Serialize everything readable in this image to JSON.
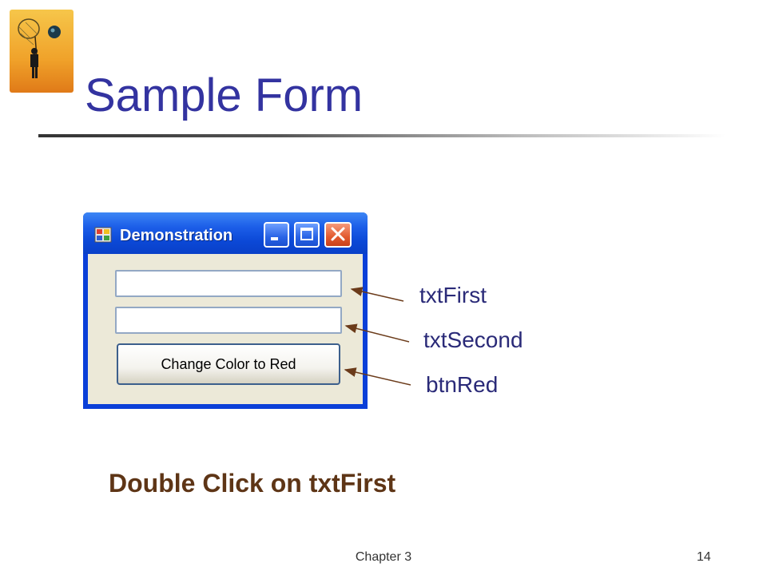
{
  "slide": {
    "title": "Sample Form",
    "instruction": "Double Click on txtFirst",
    "footer_left": "Chapter 3",
    "page_number": "14",
    "title_color": "#3333a0",
    "instruction_color": "#5e3516"
  },
  "logo": {
    "icon": "butterfly-net-figure-icon"
  },
  "form": {
    "window_title": "Demonstration",
    "app_icon": "form-app-icon",
    "textbox_first_value": "",
    "textbox_second_value": "",
    "button_label": "Change Color to Red",
    "titlebar_color": "#0a48d6"
  },
  "callouts": {
    "first": "txtFirst",
    "second": "txtSecond",
    "third": "btnRed"
  }
}
